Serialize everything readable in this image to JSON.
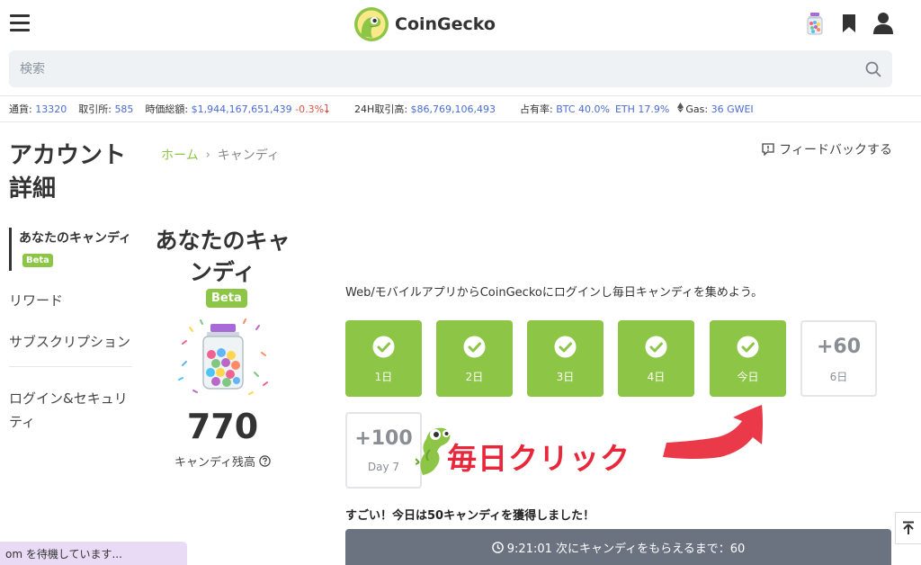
{
  "header": {
    "brand": "CoinGecko",
    "search_placeholder": "検索",
    "icons": [
      "menu-icon",
      "candy-jar-icon",
      "bookmark-icon",
      "user-icon",
      "search-icon"
    ]
  },
  "stats": {
    "coins_label": "通貨:",
    "coins_value": "13320",
    "exchanges_label": "取引所:",
    "exchanges_value": "585",
    "mcap_label": "時価総額:",
    "mcap_value": "$1,944,167,651,439",
    "mcap_change": "-0.3%",
    "volume_label": "24H取引高:",
    "volume_value": "$86,769,106,493",
    "dominance_label": "占有率:",
    "btc_dom": "BTC 40.0%",
    "eth_dom": "ETH 17.9%",
    "gas_label": "Gas:",
    "gas_value": "36 GWEI"
  },
  "sidebar": {
    "title": "アカウント詳細",
    "items": [
      {
        "label": "あなたのキャンディ",
        "badge": "Beta"
      },
      {
        "label": "リワード"
      },
      {
        "label": "サブスクリプション"
      },
      {
        "label": "ログイン&セキュリティ"
      }
    ]
  },
  "breadcrumb": {
    "home": "ホーム",
    "separator": "›",
    "current": "キャンディ"
  },
  "feedback_label": "フィードバックする",
  "candy": {
    "title": "あなたのキャンディ",
    "badge": "Beta",
    "balance": "770",
    "balance_label": "キャンディ残高"
  },
  "main": {
    "intro": "Web/モバイルアプリからCoinGeckoにログインし毎日キャンディを集めよう。",
    "days": [
      {
        "label": "1日",
        "done": true
      },
      {
        "label": "2日",
        "done": true
      },
      {
        "label": "3日",
        "done": true
      },
      {
        "label": "4日",
        "done": true
      },
      {
        "label": "今日",
        "done": true
      },
      {
        "label": "6日",
        "points": "+60",
        "done": false
      },
      {
        "label": "Day 7",
        "points": "+100",
        "done": false
      }
    ],
    "annotation": "毎日クリック",
    "success": "すごい！今日は50キャンディを獲得しました！",
    "timer": "9:21:01 次にキャンディをもらえるまで：60"
  },
  "status_bar": "om を待機しています...",
  "colors": {
    "brand_green": "#8dc647",
    "link_blue": "#4a6cd4",
    "negative_red": "#e15241",
    "annotation_red": "#e8283a",
    "timer_gray": "#6b7280"
  }
}
